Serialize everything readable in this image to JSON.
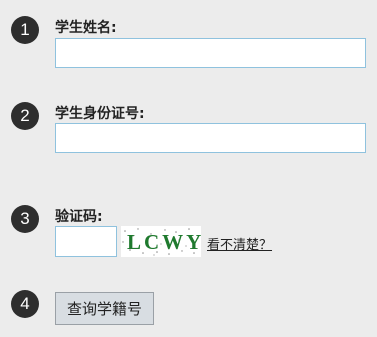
{
  "steps": [
    "1",
    "2",
    "3",
    "4"
  ],
  "student_name": {
    "label": "学生姓名:",
    "value": ""
  },
  "id_number": {
    "label": "学生身份证号:",
    "value": ""
  },
  "captcha": {
    "label": "验证码:",
    "value": "",
    "image_text": "LCWY",
    "refresh_label": "看不清楚？"
  },
  "submit_label": "查询学籍号",
  "colors": {
    "step_circle": "#2e2e2e",
    "input_border": "#8fc2de",
    "background": "#ececec",
    "captcha_text": "#1f7a2e"
  }
}
